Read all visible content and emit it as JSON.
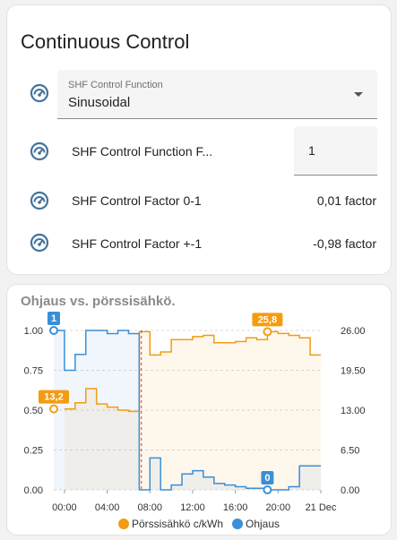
{
  "continuous_control": {
    "title": "Continuous Control",
    "select": {
      "label": "SHF Control Function",
      "value": "Sinusoidal",
      "icon": "gauge-icon"
    },
    "rows": [
      {
        "label": "SHF Control Function F...",
        "value": "1",
        "icon": "gauge-icon",
        "kind": "number-input"
      },
      {
        "label": "SHF Control Factor 0-1",
        "value": "0,01 factor",
        "icon": "gauge-icon",
        "kind": "sensor"
      },
      {
        "label": "SHF Control Factor +-1",
        "value": "-0,98 factor",
        "icon": "gauge-icon",
        "kind": "sensor"
      }
    ]
  },
  "colors": {
    "price": "#f39c12",
    "control": "#3a8fd6",
    "now_line": "#e53935",
    "grid": "#d9d9d9",
    "icon": "#44739e"
  },
  "chart_data": {
    "type": "line",
    "title": "Ohjaus vs. pörssisähkö.",
    "x_ticks": [
      "00:00",
      "04:00",
      "08:00",
      "12:00",
      "16:00",
      "20:00",
      "21 Dec"
    ],
    "x_range_hours": [
      -1,
      24
    ],
    "y_left": {
      "ticks": [
        "1.00",
        "0.75",
        "0.50",
        "0.25",
        "0.00"
      ],
      "range": [
        0,
        1
      ]
    },
    "y_right": {
      "ticks": [
        "26.00",
        "19.50",
        "13.00",
        "6.50",
        "0.00"
      ],
      "range": [
        0,
        26
      ]
    },
    "grid": true,
    "legend_position": "bottom",
    "current_time_hour": 7.2,
    "series": [
      {
        "name": "Pörssisähkö c/kWh",
        "axis": "right",
        "step": true,
        "points": [
          [
            0,
            13.2
          ],
          [
            1,
            14.2
          ],
          [
            2,
            16.5
          ],
          [
            3,
            14.0
          ],
          [
            4,
            13.5
          ],
          [
            5,
            13.0
          ],
          [
            6,
            12.8
          ],
          [
            7,
            25.8
          ],
          [
            8,
            22.0
          ],
          [
            9,
            22.5
          ],
          [
            10,
            24.5
          ],
          [
            11,
            24.5
          ],
          [
            12,
            25.0
          ],
          [
            13,
            25.2
          ],
          [
            14,
            24.0
          ],
          [
            15,
            24.0
          ],
          [
            16,
            24.2
          ],
          [
            17,
            24.8
          ],
          [
            18,
            24.5
          ],
          [
            19,
            25.8
          ],
          [
            20,
            25.5
          ],
          [
            21,
            25.2
          ],
          [
            22,
            24.8
          ],
          [
            23,
            22.0
          ]
        ],
        "marker": {
          "x": 19,
          "y": 25.8,
          "label": "25,8"
        },
        "start_marker": {
          "x": -1,
          "y": 13.2,
          "label": "13,2"
        }
      },
      {
        "name": "Ohjaus",
        "axis": "left",
        "step": true,
        "points": [
          [
            -1,
            1.0
          ],
          [
            0,
            0.75
          ],
          [
            1,
            0.85
          ],
          [
            2,
            1.0
          ],
          [
            3,
            1.0
          ],
          [
            4,
            0.98
          ],
          [
            5,
            1.0
          ],
          [
            6,
            0.98
          ],
          [
            7,
            0.0
          ],
          [
            8,
            0.2
          ],
          [
            9,
            0.0
          ],
          [
            10,
            0.03
          ],
          [
            11,
            0.1
          ],
          [
            12,
            0.12
          ],
          [
            13,
            0.08
          ],
          [
            14,
            0.04
          ],
          [
            15,
            0.03
          ],
          [
            16,
            0.02
          ],
          [
            17,
            0.01
          ],
          [
            18,
            0.01
          ],
          [
            19,
            0.0
          ],
          [
            20,
            0.0
          ],
          [
            21,
            0.02
          ],
          [
            22,
            0.15
          ],
          [
            23,
            0.15
          ]
        ],
        "marker": {
          "x": 19,
          "y": 0.0,
          "label": "0"
        },
        "start_marker": {
          "x": -1,
          "y": 1.0,
          "label": "1"
        }
      }
    ]
  }
}
